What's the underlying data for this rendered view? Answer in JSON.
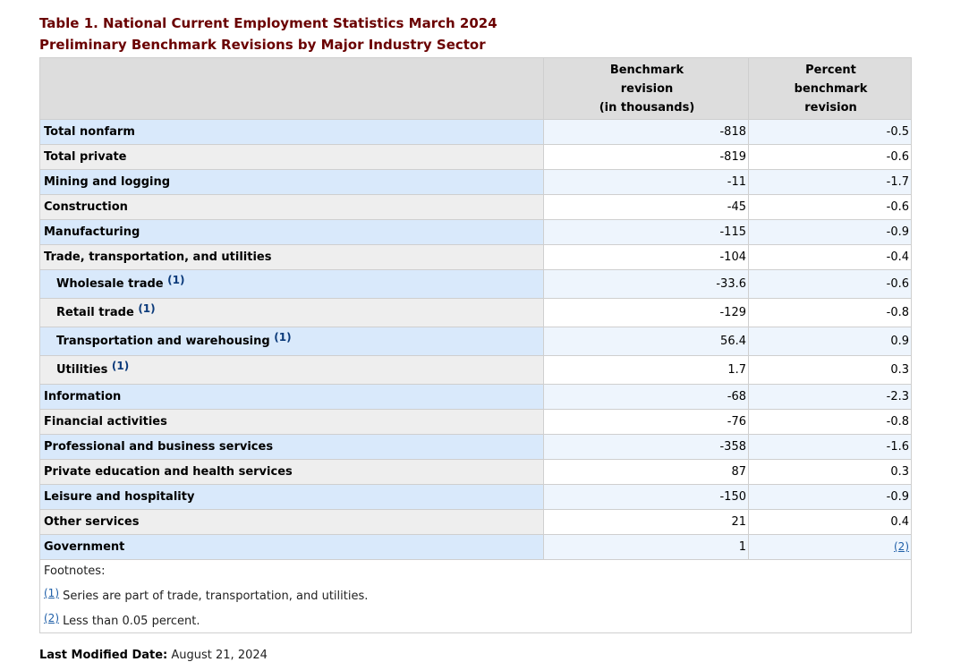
{
  "caption": {
    "line1": "Table 1. National Current Employment Statistics March 2024",
    "line2": "Preliminary Benchmark Revisions by Major Industry Sector"
  },
  "headers": {
    "col1": [
      "Benchmark",
      "revision",
      "(in thousands)"
    ],
    "col2": [
      "Percent",
      "benchmark",
      "revision"
    ]
  },
  "rows": [
    {
      "label": "Total nonfarm",
      "revision": "-818",
      "percent": "-0.5"
    },
    {
      "label": "Total private",
      "revision": "-819",
      "percent": "-0.6"
    },
    {
      "label": "Mining and logging",
      "revision": "-11",
      "percent": "-1.7"
    },
    {
      "label": "Construction",
      "revision": "-45",
      "percent": "-0.6"
    },
    {
      "label": "Manufacturing",
      "revision": "-115",
      "percent": "-0.9"
    },
    {
      "label": "Trade, transportation, and utilities",
      "revision": "-104",
      "percent": "-0.4"
    },
    {
      "label": "Wholesale trade",
      "fn": "(1)",
      "revision": "-33.6",
      "percent": "-0.6"
    },
    {
      "label": "Retail trade",
      "fn": "(1)",
      "revision": "-129",
      "percent": "-0.8"
    },
    {
      "label": "Transportation and warehousing",
      "fn": "(1)",
      "revision": "56.4",
      "percent": "0.9"
    },
    {
      "label": "Utilities",
      "fn": "(1)",
      "revision": "1.7",
      "percent": "0.3"
    },
    {
      "label": "Information",
      "revision": "-68",
      "percent": "-2.3"
    },
    {
      "label": "Financial activities",
      "revision": "-76",
      "percent": "-0.8"
    },
    {
      "label": "Professional and business services",
      "revision": "-358",
      "percent": "-1.6"
    },
    {
      "label": "Private education and health services",
      "revision": "87",
      "percent": "0.3"
    },
    {
      "label": "Leisure and hospitality",
      "revision": "-150",
      "percent": "-0.9"
    },
    {
      "label": "Other services",
      "revision": "21",
      "percent": "0.4"
    },
    {
      "label": "Government",
      "revision": "1",
      "percent_link": "(2)"
    }
  ],
  "footnotes": {
    "title": "Footnotes:",
    "items": [
      {
        "marker": "(1)",
        "text": "Series are part of trade, transportation, and utilities."
      },
      {
        "marker": "(2)",
        "text": "Less than 0.05 percent."
      }
    ]
  },
  "last_modified": {
    "label": "Last Modified Date:",
    "value": "August 21, 2024"
  }
}
